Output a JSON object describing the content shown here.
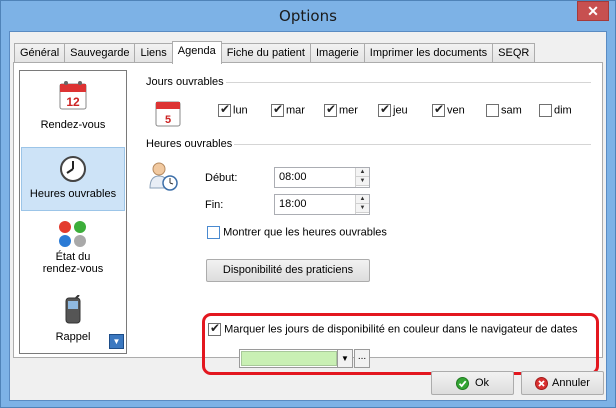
{
  "window": {
    "title": "Options",
    "close_glyph": "✕"
  },
  "tabs": [
    {
      "label": "Général"
    },
    {
      "label": "Sauvegarde"
    },
    {
      "label": "Liens"
    },
    {
      "label": "Agenda",
      "active": true
    },
    {
      "label": "Fiche du patient"
    },
    {
      "label": "Imagerie"
    },
    {
      "label": "Imprimer les documents"
    },
    {
      "label": "SEQR"
    }
  ],
  "sidebar": {
    "items": [
      {
        "label": "Rendez-vous",
        "icon": "calendar-icon",
        "calendar_day": "12"
      },
      {
        "label": "Heures ouvrables",
        "icon": "clock-icon",
        "selected": true
      },
      {
        "label_line1": "État du",
        "label_line2": "rendez-vous",
        "icon": "status-dots-icon"
      },
      {
        "label": "Rappel",
        "icon": "phone-icon"
      }
    ],
    "scroll_glyph": "▼"
  },
  "workdays": {
    "title": "Jours ouvrables",
    "calendar_day": "5",
    "days": [
      {
        "label": "lun",
        "checked": true
      },
      {
        "label": "mar",
        "checked": true
      },
      {
        "label": "mer",
        "checked": true
      },
      {
        "label": "jeu",
        "checked": true
      },
      {
        "label": "ven",
        "checked": true
      },
      {
        "label": "sam",
        "checked": false
      },
      {
        "label": "dim",
        "checked": false
      }
    ]
  },
  "hours": {
    "title": "Heures ouvrables",
    "start_label": "Début:",
    "start_value": "08:00",
    "end_label": "Fin:",
    "end_value": "18:00",
    "only_work_hours_label": "Montrer que les heures ouvrables",
    "only_work_hours_checked": false
  },
  "availability": {
    "button_label": "Disponibilité des praticiens",
    "mark_label": "Marquer les jours de disponibilité en couleur dans le navigateur de dates",
    "mark_checked": true,
    "color": "#c9f0b4",
    "ellipsis": "..."
  },
  "footer": {
    "ok_label": "Ok",
    "cancel_label": "Annuler"
  },
  "colors": {
    "accent_highlight": "#e3171f",
    "title_bar": "#7db2e6",
    "selected_item": "#cde3f7"
  }
}
